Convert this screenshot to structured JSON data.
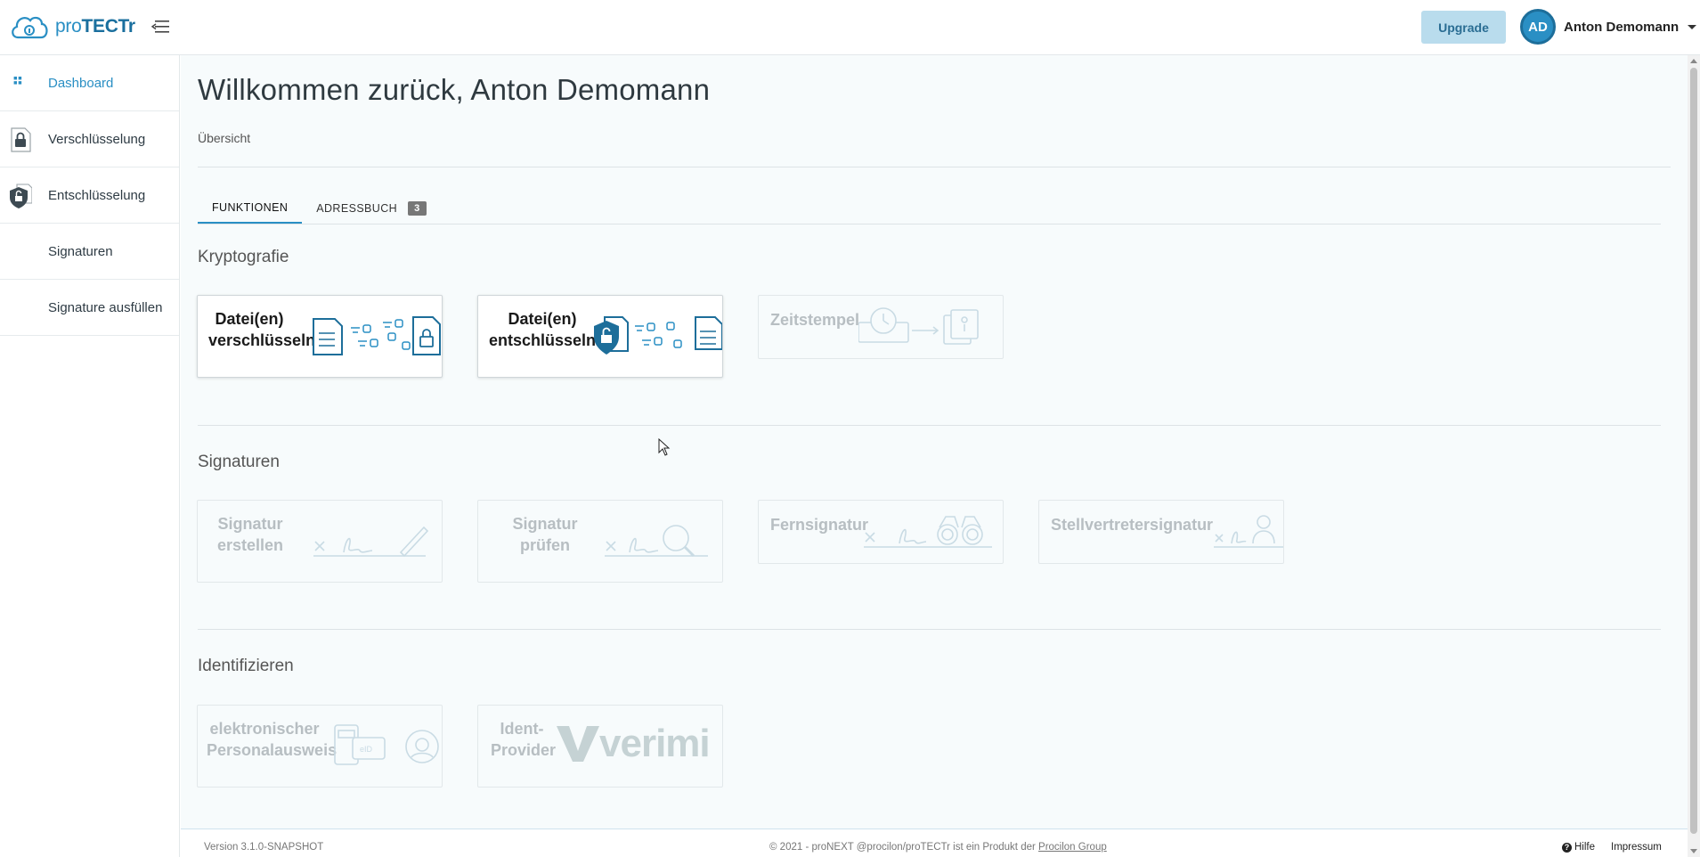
{
  "app": {
    "logo_prefix": "pro",
    "logo_suffix": "TECTr",
    "upgrade_label": "Upgrade",
    "user_initials": "AD",
    "user_name": "Anton Demomann"
  },
  "sidebar": {
    "items": [
      {
        "label": "Dashboard",
        "icon": "dashboard-grid-icon",
        "active": true
      },
      {
        "label": "Verschlüsselung",
        "icon": "lock-document-icon"
      },
      {
        "label": "Entschlüsselung",
        "icon": "unlock-shield-icon"
      },
      {
        "label": "Signaturen",
        "icon": ""
      },
      {
        "label": "Signature ausfüllen",
        "icon": ""
      }
    ]
  },
  "main": {
    "title": "Willkommen zurück, Anton Demomann",
    "breadcrumb": "Übersicht",
    "tabs": [
      {
        "label": "FUNKTIONEN",
        "active": true
      },
      {
        "label": "ADRESSBUCH",
        "badge": "3"
      }
    ],
    "sections": {
      "kryptografie": {
        "title": "Kryptografie",
        "cards": [
          {
            "label_line1": "Datei(en)",
            "label_line2": "verschlüsseln",
            "enabled": true
          },
          {
            "label_line1": "Datei(en)",
            "label_line2": "entschlüsseln",
            "enabled": true
          },
          {
            "label_line1": "Zeitstempel",
            "enabled": false
          }
        ]
      },
      "signaturen": {
        "title": "Signaturen",
        "cards": [
          {
            "label_line1": "Signatur",
            "label_line2": "erstellen",
            "enabled": false
          },
          {
            "label_line1": "Signatur",
            "label_line2": "prüfen",
            "enabled": false
          },
          {
            "label_line1": "Fernsignatur",
            "enabled": false
          },
          {
            "label_line1": "Stellvertretersignatur",
            "enabled": false
          }
        ]
      },
      "identifizieren": {
        "title": "Identifizieren",
        "cards": [
          {
            "label_line1": "elektronischer",
            "label_line2": "Personalausweis",
            "enabled": false
          },
          {
            "label_line1": "Ident-",
            "label_line2": "Provider",
            "brand": "verimi",
            "enabled": false
          }
        ]
      }
    }
  },
  "footer": {
    "version": "Version 3.1.0-SNAPSHOT",
    "copyright_text": "© 2021 - proNEXT @procilon/proTECTr ist ein Produkt der",
    "copyright_link": "Procilon Group",
    "help": "Hilfe",
    "imprint": "Impressum"
  },
  "colors": {
    "brand": "#2a8fc4",
    "brand_dark": "#1a6f9e",
    "upgrade_bg": "#b9dced",
    "main_bg": "#f7fbfc",
    "disabled_text": "#b7bec2"
  }
}
